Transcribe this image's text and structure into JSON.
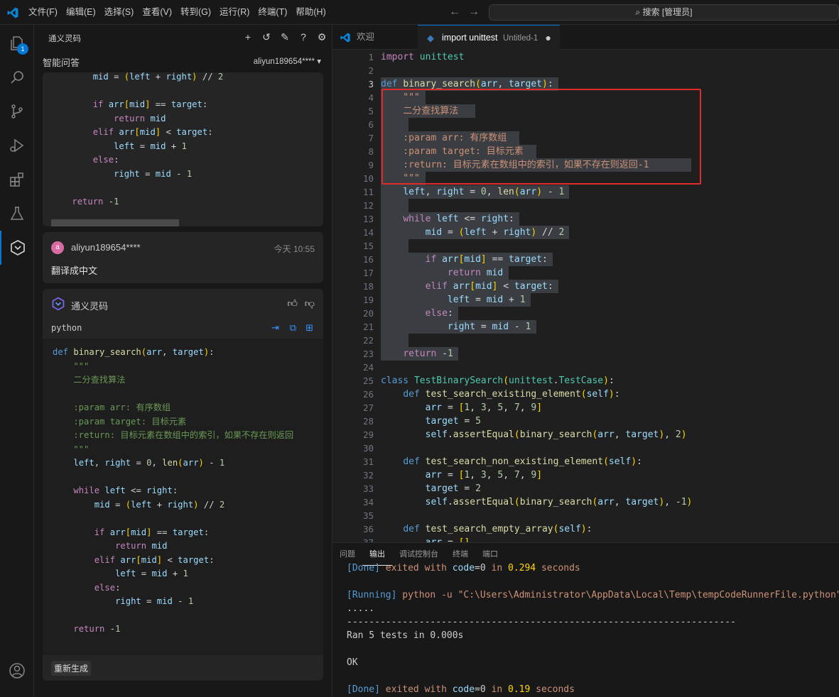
{
  "menu": [
    "文件(F)",
    "编辑(E)",
    "选择(S)",
    "查看(V)",
    "转到(G)",
    "运行(R)",
    "终端(T)",
    "帮助(H)"
  ],
  "command_center": "搜索 [管理员]",
  "explorer_badge": "1",
  "sidebar": {
    "title": "通义灵码",
    "sub_title": "智能问答",
    "user_account": "aliyun189654****"
  },
  "top_code": [
    "        mid = (left + right) // 2",
    "",
    "        if arr[mid] == target:",
    "            return mid",
    "        elif arr[mid] < target:",
    "            left = mid + 1",
    "        else:",
    "            right = mid - 1",
    "",
    "    return -1"
  ],
  "user_msg": {
    "avatar": "a",
    "name": "aliyun189654****",
    "time": "今天 10:55",
    "text": "翻译成中文"
  },
  "ai_msg": {
    "name": "通义灵码",
    "lang": "python",
    "regen": "重新生成"
  },
  "ai_code": [
    "def binary_search(arr, target):",
    "    \"\"\"",
    "    二分查找算法",
    "",
    "    :param arr: 有序数组",
    "    :param target: 目标元素",
    "    :return: 目标元素在数组中的索引，如果不存在则返回",
    "    \"\"\"",
    "    left, right = 0, len(arr) - 1",
    "",
    "    while left <= right:",
    "        mid = (left + right) // 2",
    "",
    "        if arr[mid] == target:",
    "            return mid",
    "        elif arr[mid] < target:",
    "            left = mid + 1",
    "        else:",
    "            right = mid - 1",
    "",
    "    return -1"
  ],
  "tabs": [
    {
      "label": "欢迎"
    },
    {
      "label": "import unittest",
      "sub": "Untitled-1"
    }
  ],
  "editor_lines": [
    "import unittest",
    "",
    "def binary_search(arr, target):",
    "    \"\"\"",
    "    二分查找算法",
    "",
    "    :param arr: 有序数组",
    "    :param target: 目标元素",
    "    :return: 目标元素在数组中的索引，如果不存在则返回-1",
    "    \"\"\"",
    "    left, right = 0, len(arr) - 1",
    "",
    "    while left <= right:",
    "        mid = (left + right) // 2",
    "",
    "        if arr[mid] == target:",
    "            return mid",
    "        elif arr[mid] < target:",
    "            left = mid + 1",
    "        else:",
    "            right = mid - 1",
    "",
    "    return -1",
    "",
    "class TestBinarySearch(unittest.TestCase):",
    "    def test_search_existing_element(self):",
    "        arr = [1, 3, 5, 7, 9]",
    "        target = 5",
    "        self.assertEqual(binary_search(arr, target), 2)",
    "",
    "    def test_search_non_existing_element(self):",
    "        arr = [1, 3, 5, 7, 9]",
    "        target = 2",
    "        self.assertEqual(binary_search(arr, target), -1)",
    "",
    "    def test_search_empty_array(self):",
    "        arr = []"
  ],
  "panel_tabs": [
    "问题",
    "输出",
    "调试控制台",
    "终端",
    "端口"
  ],
  "output": [
    "[Done] exited with code=0 in 0.294 seconds",
    "",
    "[Running] python -u \"C:\\Users\\Administrator\\AppData\\Local\\Temp\\tempCodeRunnerFile.python\"",
    ".....",
    "----------------------------------------------------------------------",
    "Ran 5 tests in 0.000s",
    "",
    "OK",
    "",
    "[Done] exited with code=0 in 0.19 seconds"
  ]
}
